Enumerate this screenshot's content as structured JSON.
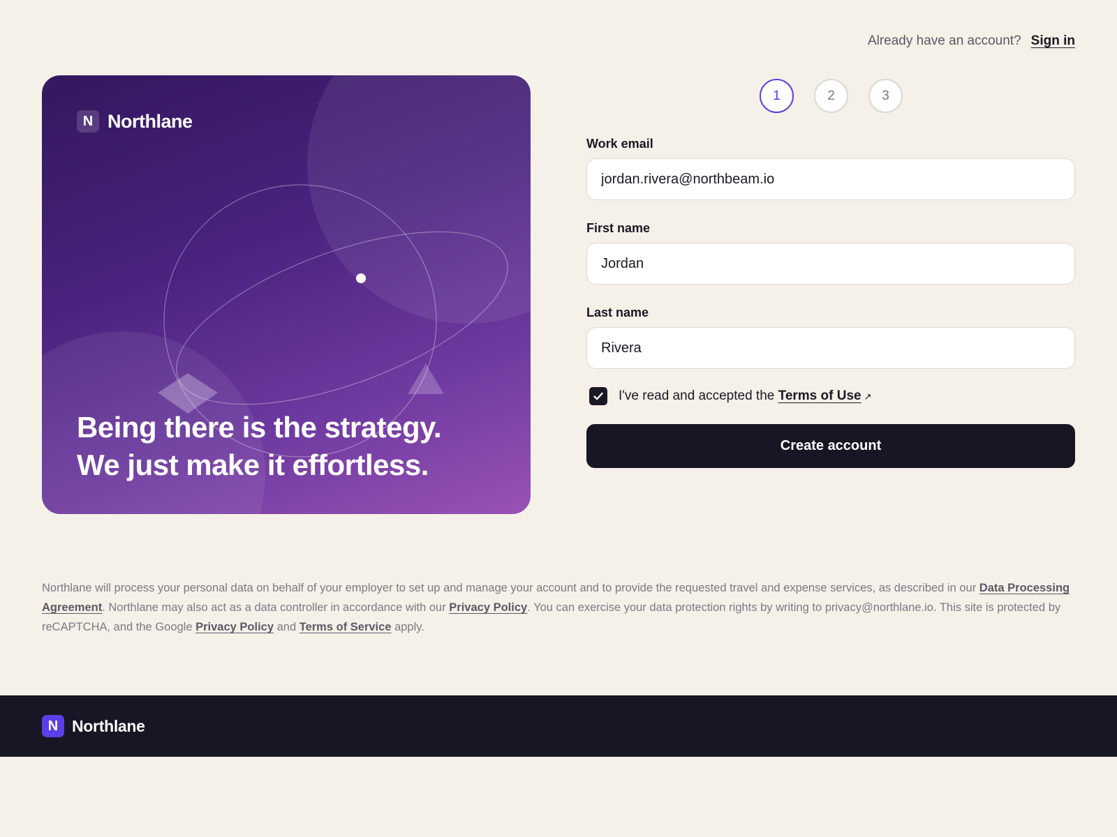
{
  "header": {
    "signin_prompt": "Already have an account?",
    "signin_link": "Sign in"
  },
  "hero": {
    "logo_letter": "N",
    "brand": "Northlane",
    "headline_line1": "Being there is the strategy.",
    "headline_line2": "We just make it effortless."
  },
  "stepper": {
    "steps": [
      "1",
      "2",
      "3"
    ],
    "active_step": "1"
  },
  "form": {
    "email_label": "Work email",
    "email_value": "jordan.rivera@northbeam.io",
    "first_name_label": "First name",
    "first_name_value": "Jordan",
    "last_name_label": "Last name",
    "last_name_value": "Rivera",
    "terms_prefix": "I've read and accepted the",
    "terms_link": "Terms of Use",
    "terms_checked": true,
    "submit_label": "Create account"
  },
  "legal": {
    "part1": "Northlane will process your personal data on behalf of your employer to set up and manage your account and to provide the requested travel and expense services, as described in our ",
    "dpa_link": "Data Processing Agreement",
    "part2": ". Northlane may also act as a data controller in accordance with our ",
    "privacy_link": "Privacy Policy",
    "part3": ". You can exercise your data protection rights by writing to privacy@northlane.io. This site is protected by reCAPTCHA, and the Google ",
    "google_privacy_link": "Privacy Policy",
    "part4": " and ",
    "google_terms_link": "Terms of Service",
    "part5": " apply."
  },
  "footer": {
    "logo_letter": "N",
    "brand": "Northlane"
  },
  "colors": {
    "background": "#f5f1e8",
    "accent": "#5b3fd6",
    "dark": "#181624",
    "footer_logo": "#5b3fe8"
  }
}
